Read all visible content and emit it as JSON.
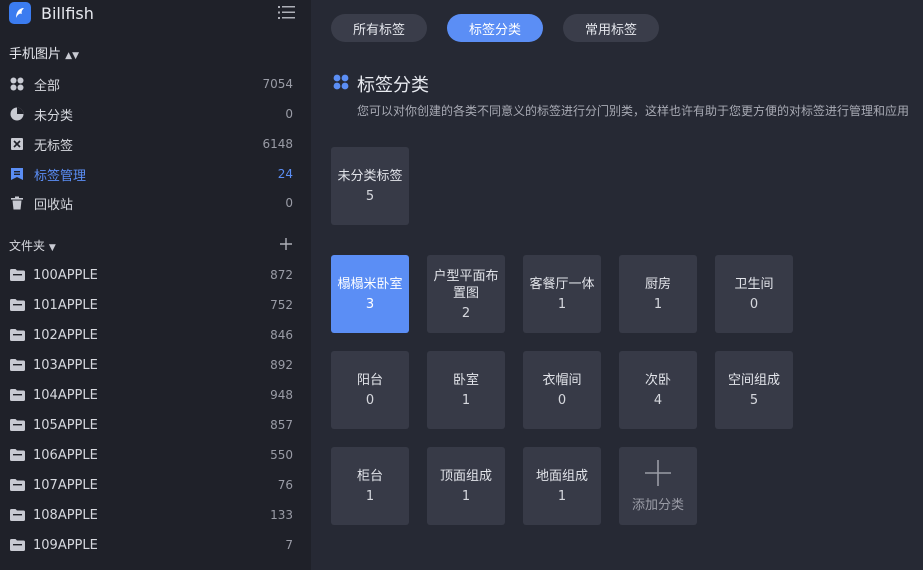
{
  "app": {
    "name": "Billfish",
    "accent": "#5b8ef5"
  },
  "library": {
    "title": "手机图片"
  },
  "nav": [
    {
      "label": "全部",
      "count": "7054",
      "icon": "all-icon"
    },
    {
      "label": "未分类",
      "count": "0",
      "icon": "uncategorized-icon"
    },
    {
      "label": "无标签",
      "count": "6148",
      "icon": "untagged-icon"
    },
    {
      "label": "标签管理",
      "count": "24",
      "icon": "tag-manage-icon",
      "active": true
    },
    {
      "label": "回收站",
      "count": "0",
      "icon": "trash-icon"
    }
  ],
  "folders": {
    "title": "文件夹",
    "items": [
      {
        "label": "100APPLE",
        "count": "872"
      },
      {
        "label": "101APPLE",
        "count": "752"
      },
      {
        "label": "102APPLE",
        "count": "846"
      },
      {
        "label": "103APPLE",
        "count": "892"
      },
      {
        "label": "104APPLE",
        "count": "948"
      },
      {
        "label": "105APPLE",
        "count": "857"
      },
      {
        "label": "106APPLE",
        "count": "550"
      },
      {
        "label": "107APPLE",
        "count": "76"
      },
      {
        "label": "108APPLE",
        "count": "133"
      },
      {
        "label": "109APPLE",
        "count": "7"
      }
    ]
  },
  "tabs": [
    {
      "label": "所有标签"
    },
    {
      "label": "标签分类",
      "active": true
    },
    {
      "label": "常用标签"
    }
  ],
  "section": {
    "title": "标签分类",
    "description": "您可以对你创建的各类不同意义的标签进行分门别类，这样也许有助于您更方便的对标签进行管理和应用"
  },
  "uncategorized": {
    "name": "未分类标签",
    "count": "5"
  },
  "categories": [
    {
      "name": "榻榻米卧室",
      "count": "3",
      "active": true
    },
    {
      "name": "户型平面布置图",
      "count": "2"
    },
    {
      "name": "客餐厅一体",
      "count": "1"
    },
    {
      "name": "厨房",
      "count": "1"
    },
    {
      "name": "卫生间",
      "count": "0"
    },
    {
      "name": "阳台",
      "count": "0"
    },
    {
      "name": "卧室",
      "count": "1"
    },
    {
      "name": "衣帽间",
      "count": "0"
    },
    {
      "name": "次卧",
      "count": "4"
    },
    {
      "name": "空间组成",
      "count": "5"
    },
    {
      "name": "柜台",
      "count": "1"
    },
    {
      "name": "顶面组成",
      "count": "1"
    },
    {
      "name": "地面组成",
      "count": "1"
    }
  ],
  "add_category": {
    "label": "添加分类"
  }
}
